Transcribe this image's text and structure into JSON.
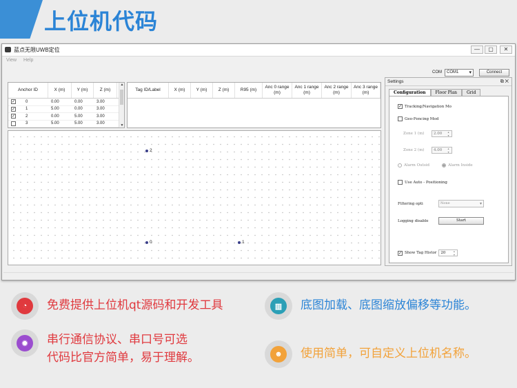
{
  "banner": {
    "title": "上位机代码"
  },
  "window": {
    "title": "蓝点无限UWB定位",
    "controls": [
      "—",
      "▢",
      "✕"
    ],
    "menu": [
      "View",
      "Help"
    ],
    "com_label": "COM",
    "com_value": "COM1",
    "connect_label": "Connect"
  },
  "anchor_table": {
    "headers": [
      "Anchor ID",
      "X (m)",
      "Y (m)",
      "Z (m)"
    ],
    "rows": [
      {
        "checked": true,
        "id": "0",
        "x": "0.00",
        "y": "0.00",
        "z": "3.00"
      },
      {
        "checked": true,
        "id": "1",
        "x": "5.00",
        "y": "0.00",
        "z": "3.00"
      },
      {
        "checked": true,
        "id": "2",
        "x": "0.00",
        "y": "5.00",
        "z": "3.00"
      },
      {
        "checked": false,
        "id": "3",
        "x": "5.00",
        "y": "5.00",
        "z": "3.00"
      }
    ]
  },
  "tag_table": {
    "headers": [
      "Tag ID/Label",
      "X (m)",
      "Y (m)",
      "Z (m)",
      "R95 (m)",
      "Anc 0 range (m)",
      "Anc 1 range (m)",
      "Anc 2 range (m)",
      "Anc 3 range (m)"
    ]
  },
  "plot": {
    "anchors": [
      {
        "label": "2"
      },
      {
        "label": "0"
      },
      {
        "label": "1"
      }
    ]
  },
  "settings": {
    "title": "Settings",
    "tabs": [
      "Configuration",
      "Floor Plan",
      "Grid"
    ],
    "tracking_label": "Tracking/Navigation Mo",
    "tracking_checked": true,
    "geofencing_label": "Geo-Fencing Mod",
    "zone1_label": "Zone 1 (m)",
    "zone1_value": "2.00",
    "zone2_label": "Zone 2 (m)",
    "zone2_value": "4.00",
    "alarm_outside_label": "Alarm Outsid",
    "alarm_inside_label": "Alarm Inside",
    "auto_pos_label": "Use Auto - Positioning",
    "filtering_label": "Filtering opti",
    "filtering_value": "None",
    "logging_label": "Logging disable",
    "start_label": "Start",
    "show_tag_label": "Show Tag Histor",
    "show_tag_value": "20"
  },
  "features": [
    {
      "icon": "pie-chart-icon",
      "text": "免费提供上位机qt源码和开发工具",
      "color": "#e0393e"
    },
    {
      "icon": "bar-chart-icon",
      "text": "底图加载、底图缩放偏移等功能。",
      "color": "#2b84d6"
    },
    {
      "icon": "gear-icon",
      "text_line1": "串行通信协议、串口号可选",
      "text_line2": "代码比官方简单，易于理解。",
      "color": "#9b4dcf"
    },
    {
      "icon": "user-icon",
      "text": "使用简单，可自定义上位机名称。",
      "color": "#f2a23a"
    }
  ]
}
